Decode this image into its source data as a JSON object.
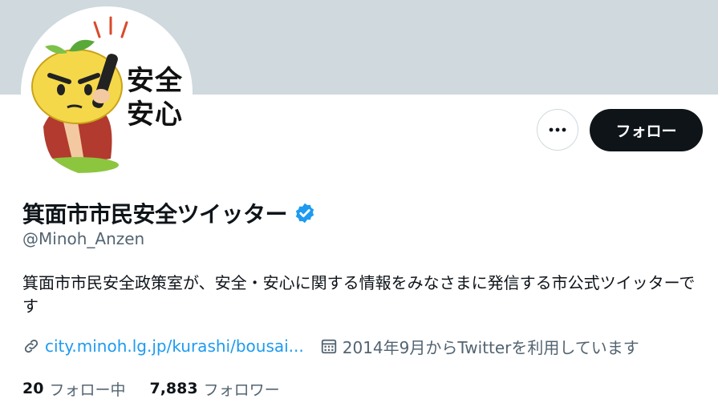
{
  "profile": {
    "display_name": "箕面市市民安全ツイッター",
    "handle": "@Minoh_Anzen",
    "bio": "箕面市市民安全政策室が、安全・安心に関する情報をみなさまに発信する市公式ツイッターです",
    "link_text": "city.minoh.lg.jp/kurashi/bousai...",
    "joined": "2014年9月からTwitterを利用しています",
    "verified_icon": "verified-badge-icon",
    "avatar_text": [
      "安全",
      "安心"
    ]
  },
  "actions": {
    "more_label": "···",
    "follow_label": "フォロー"
  },
  "stats": {
    "following_count": "20",
    "following_label": "フォロー中",
    "followers_count": "7,883",
    "followers_label": "フォロワー"
  },
  "colors": {
    "banner": "#cfd9de",
    "accent": "#1d9bf0",
    "text": "#0f1419",
    "secondary": "#536471",
    "follow_button": "#0f1419"
  }
}
